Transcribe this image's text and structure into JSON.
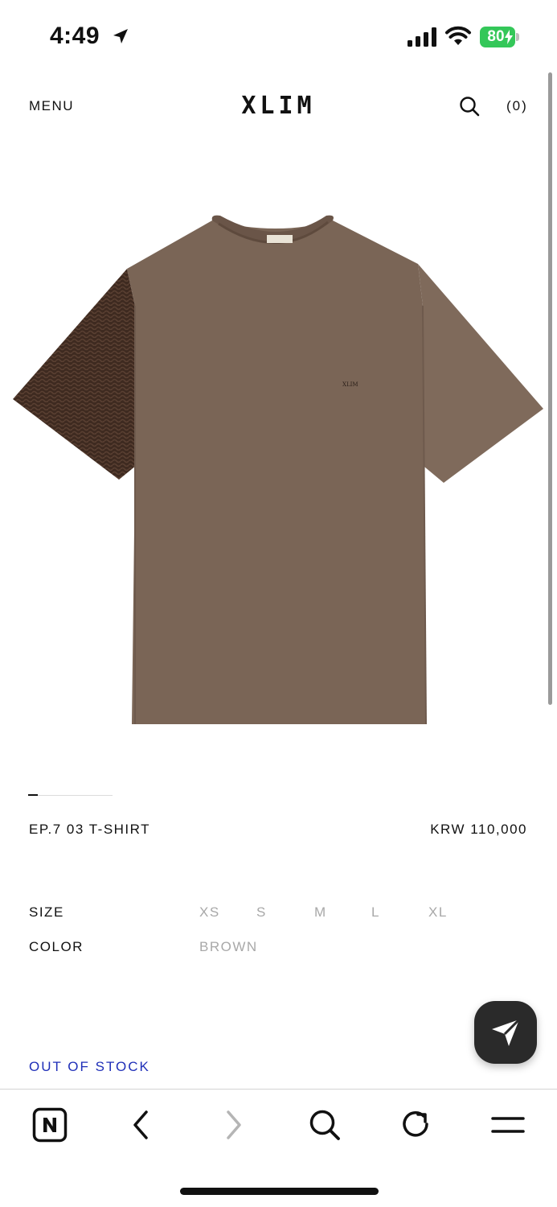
{
  "status_bar": {
    "time": "4:49",
    "battery": "80",
    "icons": [
      "location-arrow-icon",
      "cellular-signal-icon",
      "wifi-icon",
      "battery-charging-icon"
    ]
  },
  "header": {
    "menu": "MENU",
    "logo": "XLIM",
    "cart": "(0)",
    "search_icon": "search-icon"
  },
  "product": {
    "image_description": "brown t-shirt with knit sleeve",
    "name": "EP.7 03 T-SHIRT",
    "price": "KRW 110,000",
    "carousel": {
      "current": 1
    },
    "options": {
      "size_label": "SIZE",
      "sizes": [
        "XS",
        "S",
        "M",
        "L",
        "XL"
      ],
      "color_label": "COLOR",
      "color_value": "BROWN"
    },
    "stock_status": "OUT OF STOCK"
  },
  "floating_button": {
    "icon": "send-icon"
  },
  "browser_toolbar": {
    "icons": [
      "naver-n-icon",
      "back-arrow-icon",
      "forward-arrow-icon",
      "search-icon",
      "reload-icon",
      "menu-icon"
    ]
  },
  "colors": {
    "accent_link": "#1f2fb8",
    "battery_green": "#34c759",
    "muted_text": "#a8a8a8",
    "shirt_brown": "#7a6556",
    "knit_dark": "#3e2a20"
  }
}
